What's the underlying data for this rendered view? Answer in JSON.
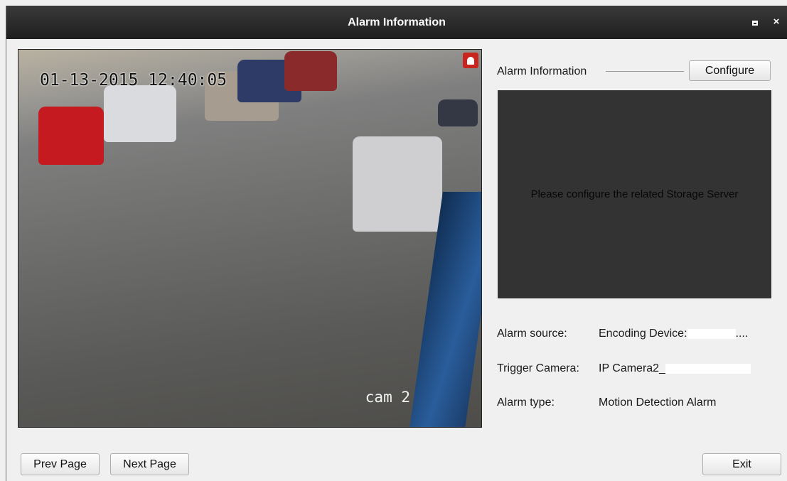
{
  "window": {
    "title": "Alarm Information",
    "maximize_icon": "maximize-icon",
    "close_icon": "close-icon",
    "close_glyph": "×"
  },
  "video": {
    "timestamp": "01-13-2015 12:40:05",
    "camera_label": "cam 2",
    "alarm_badge_icon": "bell-icon"
  },
  "alarm_panel": {
    "section_title": "Alarm Information",
    "configure_label": "Configure",
    "storage_message": "Please configure the related Storage Server"
  },
  "details": {
    "source_label": "Alarm source:",
    "source_value_prefix": "Encoding Device:",
    "source_value_suffix": "....",
    "trigger_label": "Trigger Camera:",
    "trigger_value_prefix": "IP Camera2_",
    "type_label": "Alarm type:",
    "type_value": "Motion Detection Alarm"
  },
  "footer": {
    "prev_label": "Prev Page",
    "next_label": "Next Page",
    "exit_label": "Exit"
  },
  "colors": {
    "titlebar": "#262626",
    "panel_dark": "#333333",
    "alarm_red": "#c8251f"
  }
}
